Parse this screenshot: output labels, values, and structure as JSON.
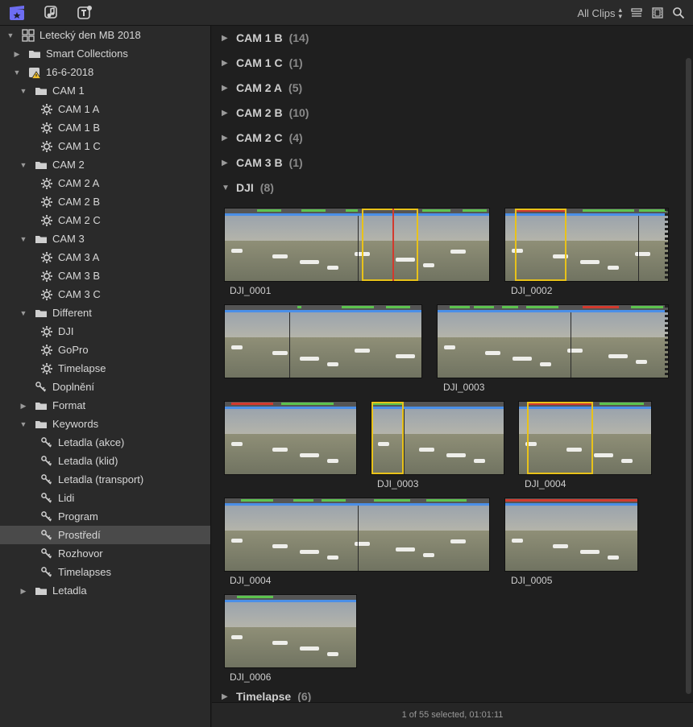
{
  "toolbar": {
    "filter_label": "All Clips",
    "icons": [
      "libraries-icon",
      "photos-audio-icon",
      "titles-generators-icon"
    ],
    "right_icons": [
      "list-view-icon",
      "filmstrip-view-icon",
      "search-icon"
    ]
  },
  "sidebar": {
    "items": [
      {
        "label": "Letecký den MB 2018",
        "level": 0,
        "tri": "open",
        "icon": "library-icon"
      },
      {
        "label": "Smart Collections",
        "level": 1,
        "tri": "closed",
        "icon": "folder-icon"
      },
      {
        "label": "16-6-2018",
        "level": 1,
        "tri": "open",
        "icon": "event-warning-icon"
      },
      {
        "label": "CAM 1",
        "level": 2,
        "tri": "open",
        "icon": "folder-icon"
      },
      {
        "label": "CAM 1 A",
        "level": 3,
        "tri": "",
        "icon": "gear-icon"
      },
      {
        "label": "CAM 1 B",
        "level": 3,
        "tri": "",
        "icon": "gear-icon"
      },
      {
        "label": "CAM 1 C",
        "level": 3,
        "tri": "",
        "icon": "gear-icon"
      },
      {
        "label": "CAM 2",
        "level": 2,
        "tri": "open",
        "icon": "folder-icon"
      },
      {
        "label": "CAM 2 A",
        "level": 3,
        "tri": "",
        "icon": "gear-icon"
      },
      {
        "label": "CAM 2 B",
        "level": 3,
        "tri": "",
        "icon": "gear-icon"
      },
      {
        "label": "CAM 2 C",
        "level": 3,
        "tri": "",
        "icon": "gear-icon"
      },
      {
        "label": "CAM 3",
        "level": 2,
        "tri": "open",
        "icon": "folder-icon"
      },
      {
        "label": "CAM 3 A",
        "level": 3,
        "tri": "",
        "icon": "gear-icon"
      },
      {
        "label": "CAM 3 B",
        "level": 3,
        "tri": "",
        "icon": "gear-icon"
      },
      {
        "label": "CAM 3 C",
        "level": 3,
        "tri": "",
        "icon": "gear-icon"
      },
      {
        "label": "Different",
        "level": 2,
        "tri": "open",
        "icon": "folder-icon"
      },
      {
        "label": "DJI",
        "level": 3,
        "tri": "",
        "icon": "gear-icon"
      },
      {
        "label": "GoPro",
        "level": 3,
        "tri": "",
        "icon": "gear-icon"
      },
      {
        "label": "Timelapse",
        "level": 3,
        "tri": "",
        "icon": "gear-icon"
      },
      {
        "label": "Doplnění",
        "level": 2,
        "tri": "",
        "icon": "keyword-icon"
      },
      {
        "label": "Format",
        "level": 2,
        "tri": "closed",
        "icon": "folder-icon"
      },
      {
        "label": "Keywords",
        "level": 2,
        "tri": "open",
        "icon": "folder-icon"
      },
      {
        "label": "Letadla (akce)",
        "level": 3,
        "tri": "",
        "icon": "keyword-icon"
      },
      {
        "label": "Letadla (klid)",
        "level": 3,
        "tri": "",
        "icon": "keyword-icon"
      },
      {
        "label": "Letadla (transport)",
        "level": 3,
        "tri": "",
        "icon": "keyword-icon"
      },
      {
        "label": "Lidi",
        "level": 3,
        "tri": "",
        "icon": "keyword-icon"
      },
      {
        "label": "Program",
        "level": 3,
        "tri": "",
        "icon": "keyword-icon"
      },
      {
        "label": "Prostředí",
        "level": 3,
        "tri": "",
        "icon": "keyword-icon",
        "selected": true
      },
      {
        "label": "Rozhovor",
        "level": 3,
        "tri": "",
        "icon": "keyword-icon"
      },
      {
        "label": "Timelapses",
        "level": 3,
        "tri": "",
        "icon": "keyword-icon"
      },
      {
        "label": "Letadla",
        "level": 2,
        "tri": "closed",
        "icon": "folder-icon"
      }
    ]
  },
  "groups": [
    {
      "name": "CAM 1 B",
      "count": "(14)",
      "open": false
    },
    {
      "name": "CAM 1 C",
      "count": "(1)",
      "open": false
    },
    {
      "name": "CAM 2 A",
      "count": "(5)",
      "open": false
    },
    {
      "name": "CAM 2 B",
      "count": "(10)",
      "open": false
    },
    {
      "name": "CAM 2 C",
      "count": "(4)",
      "open": false
    },
    {
      "name": "CAM 3 B",
      "count": "(1)",
      "open": false
    },
    {
      "name": "DJI",
      "count": "(8)",
      "open": true
    },
    {
      "name": "Timelapse",
      "count": "(6)",
      "open": false
    }
  ],
  "clips": [
    {
      "name": "DJI_0001"
    },
    {
      "name": "DJI_0002"
    },
    {
      "name": ""
    },
    {
      "name": "DJI_0003"
    },
    {
      "name": ""
    },
    {
      "name": "DJI_0003"
    },
    {
      "name": "DJI_0004"
    },
    {
      "name": "DJI_0004"
    },
    {
      "name": "DJI_0005"
    },
    {
      "name": "DJI_0006"
    }
  ],
  "colors": {
    "keyword_bar": "#4a8fe8",
    "favorite_bar": "#5cc34e",
    "reject_bar": "#d23a2e",
    "selection": "#e8c21a",
    "accent_icon": "#6d6df2"
  },
  "status": {
    "text": "1 of 55 selected, 01:01:11"
  }
}
